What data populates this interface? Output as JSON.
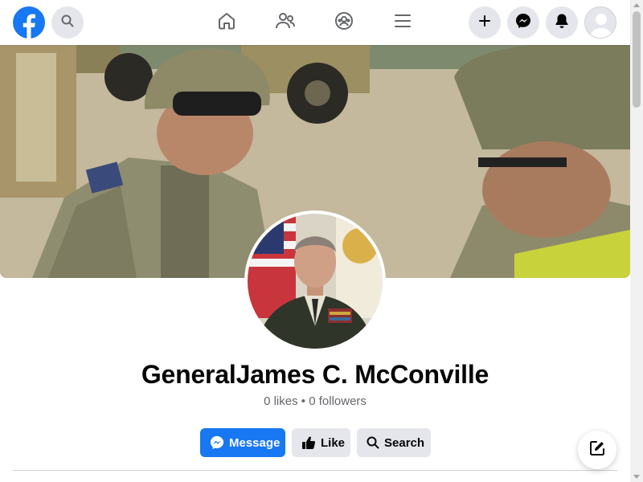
{
  "profile": {
    "name": "GeneralJames C. McConville",
    "likes": "0 likes",
    "separator": "•",
    "followers": "0 followers"
  },
  "actions": {
    "message_label": "Message",
    "like_label": "Like",
    "search_label": "Search"
  },
  "icons": {
    "logo": "facebook-logo",
    "search": "search-icon",
    "home": "home-icon",
    "friends": "friends-icon",
    "groups": "groups-icon",
    "menu": "hamburger-menu-icon",
    "create": "plus-icon",
    "messenger": "messenger-icon",
    "notifications": "bell-icon",
    "account": "avatar",
    "compose": "compose-icon"
  },
  "colors": {
    "brand": "#1877f2",
    "secondary_button": "#e4e6eb",
    "text_primary": "#050505",
    "text_secondary": "#65676b"
  }
}
